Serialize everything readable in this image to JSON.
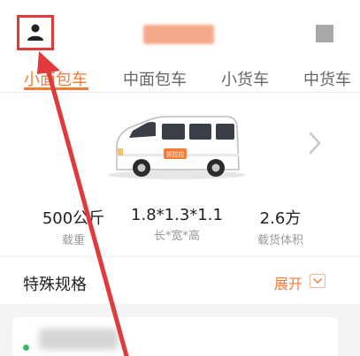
{
  "header": {
    "profile_icon": "user-icon",
    "highlight_color": "#e03a3a"
  },
  "tabs": [
    {
      "label": "小面包车",
      "active": true
    },
    {
      "label": "中面包车",
      "active": false
    },
    {
      "label": "小货车",
      "active": false
    },
    {
      "label": "中货车",
      "active": false
    }
  ],
  "accent_color": "#f47a36",
  "vehicle": {
    "badge": "货拉拉",
    "next_icon": "chevron-right-icon"
  },
  "specs": [
    {
      "value": "500公斤",
      "label": "载重"
    },
    {
      "value": "1.8*1.3*1.1",
      "label": "长*宽*高"
    },
    {
      "value": "2.6方",
      "label": "载货体积"
    }
  ],
  "special": {
    "label": "特殊规格",
    "expand_label": "展开",
    "expand_icon": "chevron-down-icon"
  },
  "route": {
    "start_dot_color": "#3db86b"
  }
}
